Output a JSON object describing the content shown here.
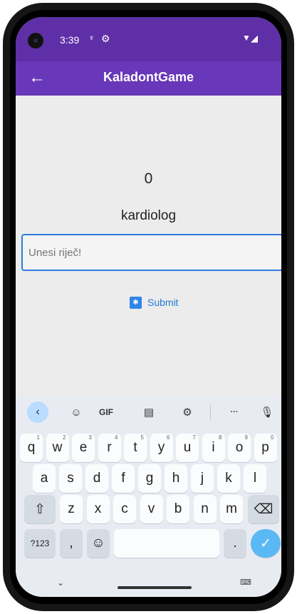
{
  "status_bar": {
    "time": "3:39"
  },
  "app_bar": {
    "back_icon": "arrow-left-icon",
    "title": "KaladontGame"
  },
  "main": {
    "score": "0",
    "current_word": "kardiolog",
    "input": {
      "placeholder": "Unesi riječ!",
      "value": ""
    },
    "submit_label": "Submit"
  },
  "keyboard": {
    "toolbar": {
      "gif_label": "GIF",
      "more_label": "···"
    },
    "row1": [
      {
        "k": "q",
        "n": "1"
      },
      {
        "k": "w",
        "n": "2"
      },
      {
        "k": "e",
        "n": "3"
      },
      {
        "k": "r",
        "n": "4"
      },
      {
        "k": "t",
        "n": "5"
      },
      {
        "k": "y",
        "n": "6"
      },
      {
        "k": "u",
        "n": "7"
      },
      {
        "k": "i",
        "n": "8"
      },
      {
        "k": "o",
        "n": "9"
      },
      {
        "k": "p",
        "n": "0"
      }
    ],
    "row2": [
      "a",
      "s",
      "d",
      "f",
      "g",
      "h",
      "j",
      "k",
      "l"
    ],
    "row3": [
      "z",
      "x",
      "c",
      "v",
      "b",
      "n",
      "m"
    ],
    "symbols_label": "?123",
    "comma_label": ",",
    "period_label": "."
  },
  "colors": {
    "status_bar": "#5e2fa6",
    "app_bar": "#6937b9",
    "input_border": "#2c7be0",
    "submit_text": "#2379d6",
    "enter_key": "#5ab9f5"
  }
}
